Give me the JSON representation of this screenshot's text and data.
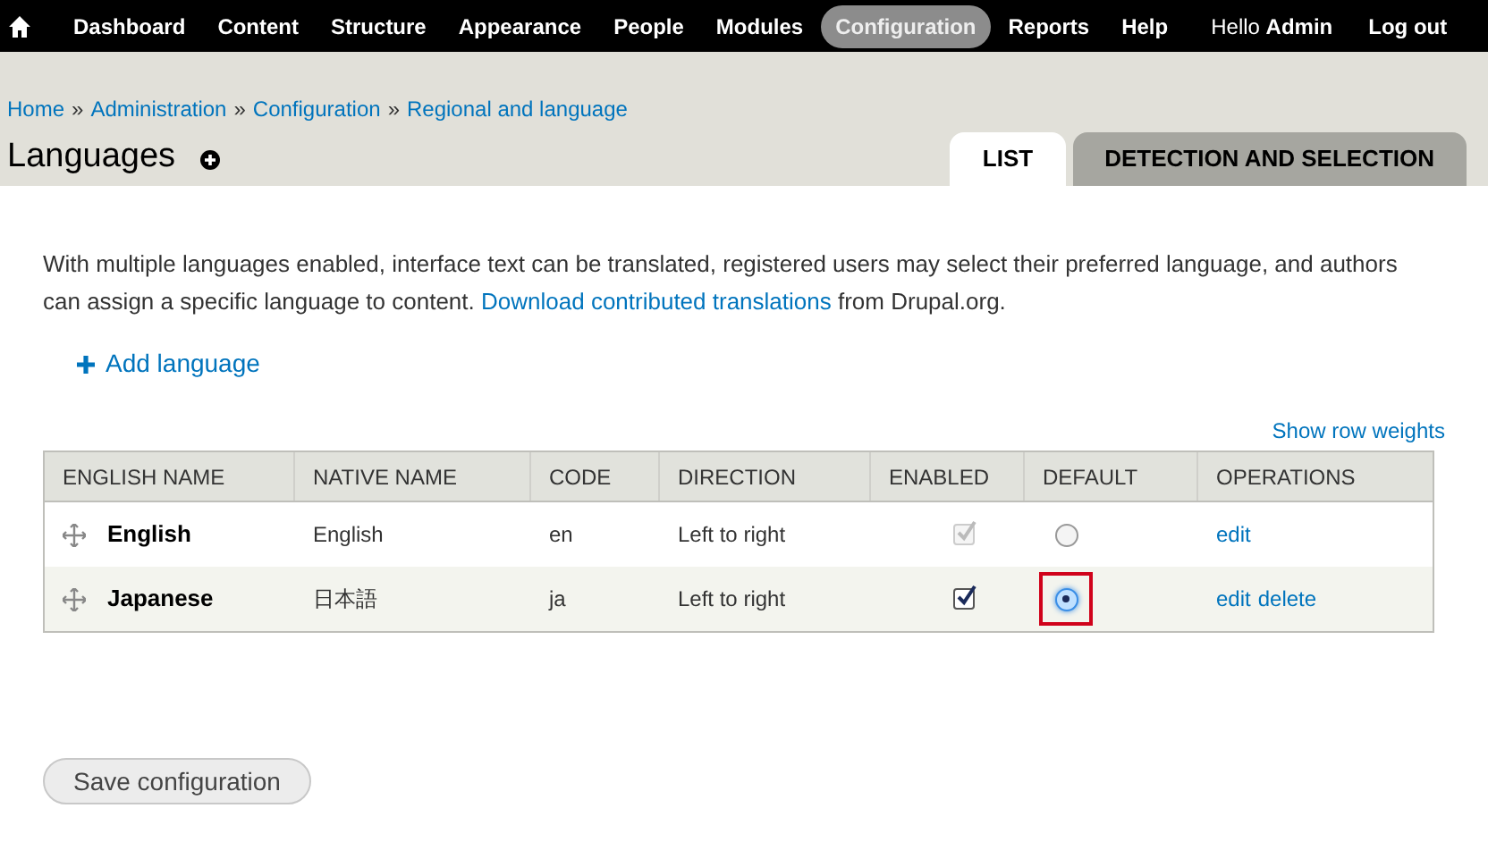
{
  "toolbar": {
    "items": [
      {
        "label": "Dashboard",
        "selected": false
      },
      {
        "label": "Content",
        "selected": false
      },
      {
        "label": "Structure",
        "selected": false
      },
      {
        "label": "Appearance",
        "selected": false
      },
      {
        "label": "People",
        "selected": false
      },
      {
        "label": "Modules",
        "selected": false
      },
      {
        "label": "Configuration",
        "selected": true
      },
      {
        "label": "Reports",
        "selected": false
      },
      {
        "label": "Help",
        "selected": false
      }
    ],
    "user": "Hello **Admin**",
    "logout": "Log out"
  },
  "breadcrumb": [
    "Home",
    "Administration",
    "Configuration",
    "Regional and language"
  ],
  "breadcrumb_separator": "»",
  "page_title": "Languages",
  "tabs": [
    {
      "label": "LIST",
      "selected": true
    },
    {
      "label": "DETECTION AND SELECTION",
      "selected": false
    }
  ],
  "intro": {
    "text": "With multiple languages enabled, interface text can be translated, registered users may select their preferred language, and authors can assign a specific language to content.",
    "link": "Download contributed translations",
    "suffix": "from Drupal.org."
  },
  "add_language": "Add language",
  "show_row_weights": "Show row weights",
  "table": {
    "columns": [
      "ENGLISH NAME",
      "NATIVE NAME",
      "CODE",
      "DIRECTION",
      "ENABLED",
      "DEFAULT",
      "OPERATIONS"
    ],
    "rows": [
      {
        "english_name": "English",
        "native_name": "English",
        "code": "en",
        "direction": "Left to right",
        "enabled": {
          "checked": true,
          "disabled": true
        },
        "default": {
          "selected": false,
          "highlighted": false
        },
        "operations": [
          "edit"
        ]
      },
      {
        "english_name": "Japanese",
        "native_name": "日本語",
        "code": "ja",
        "direction": "Left to right",
        "enabled": {
          "checked": true,
          "disabled": false
        },
        "default": {
          "selected": true,
          "highlighted": true
        },
        "operations": [
          "edit",
          "delete"
        ]
      }
    ]
  },
  "save_button": "Save configuration"
}
